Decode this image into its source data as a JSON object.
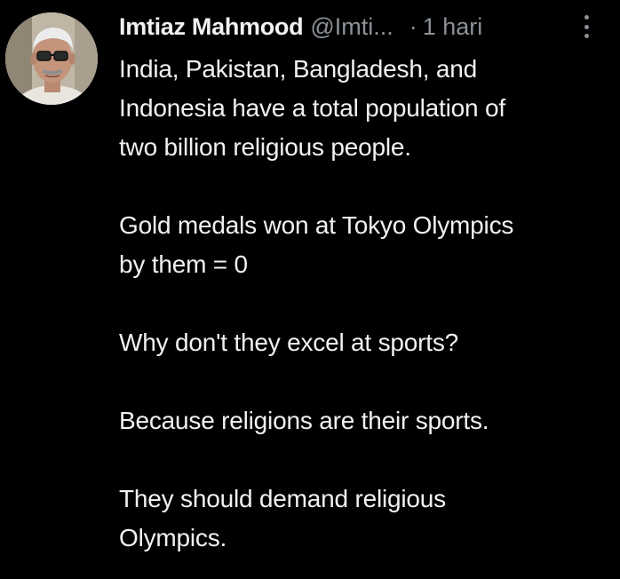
{
  "tweet": {
    "author_name": "Imtiaz Mahmood",
    "handle": "@Imti...",
    "separator": "·",
    "time": "1 hari",
    "more_icon": "more-vertical-icon",
    "avatar_icon": "profile-photo",
    "paragraphs": [
      "India, Pakistan, Bangladesh, and\nIndonesia have a total population of\ntwo billion religious people.",
      "Gold medals won at Tokyo Olympics\nby them = 0",
      "Why don't they excel at sports?",
      "Because religions are their sports.",
      "They should demand religious\nOlympics."
    ]
  },
  "colors": {
    "background": "#000000",
    "text": "#f1f1f1",
    "muted": "#8b9197"
  }
}
